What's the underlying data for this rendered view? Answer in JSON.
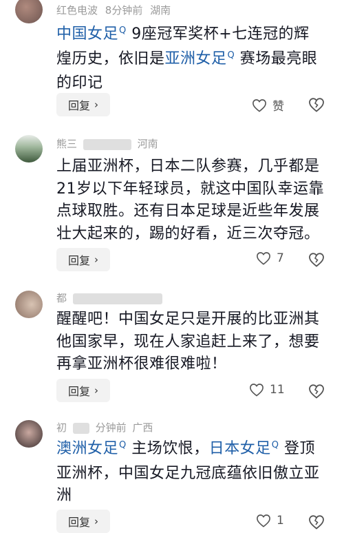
{
  "comments": [
    {
      "author": "红色电波",
      "time": "8分钟前",
      "location": "湖南",
      "segments": [
        {
          "text": "中国女足",
          "link": true
        },
        {
          "text": " 9座冠军奖杯+七连冠的辉煌历史，依旧是",
          "link": false
        },
        {
          "text": "亚洲女足",
          "link": true
        },
        {
          "text": " 赛场最亮眼的印记",
          "link": false
        }
      ],
      "reply_label": "回复",
      "like_label": "赞",
      "avatar_color": "#8b6f66"
    },
    {
      "author": "熊三",
      "time": "",
      "location": "河南",
      "segments": [
        {
          "text": "上届亚洲杯，日本二队参赛，几乎都是21岁以下年轻球员，就这中国队幸运靠点球取胜。还有日本足球是近些年发展壮大起来的，踢的好看，近三次夺冠。",
          "link": false
        }
      ],
      "reply_label": "回复",
      "like_label": "7",
      "avatar_color": "#5b7c5a"
    },
    {
      "author": "都",
      "time": "",
      "location": "",
      "segments": [
        {
          "text": "醒醒吧！中国女足只是开展的比亚洲其他国家早，现在人家追赶上来了，想要再拿亚洲杯很难很难啦！",
          "link": false
        }
      ],
      "reply_label": "回复",
      "like_label": "11",
      "avatar_color": "#b89c86"
    },
    {
      "author": "初",
      "time": "分钟前",
      "location": "广西",
      "segments": [
        {
          "text": "澳洲女足",
          "link": true
        },
        {
          "text": " 主场饮恨，",
          "link": false
        },
        {
          "text": "日本女足",
          "link": true
        },
        {
          "text": " 登顶亚洲杯，中国女足九冠底蕴依旧傲立亚洲",
          "link": false
        }
      ],
      "reply_label": "回复",
      "like_label": "1",
      "avatar_color": "#6a5a58"
    }
  ],
  "icons": {
    "search": "search-icon",
    "heart": "heart-icon",
    "dislike": "broken-heart-icon",
    "chevron": "chevron-right-icon"
  },
  "colors": {
    "link": "#1f5fa8",
    "reply_bg": "#f2f2f2",
    "meta": "#9a9a9a"
  }
}
